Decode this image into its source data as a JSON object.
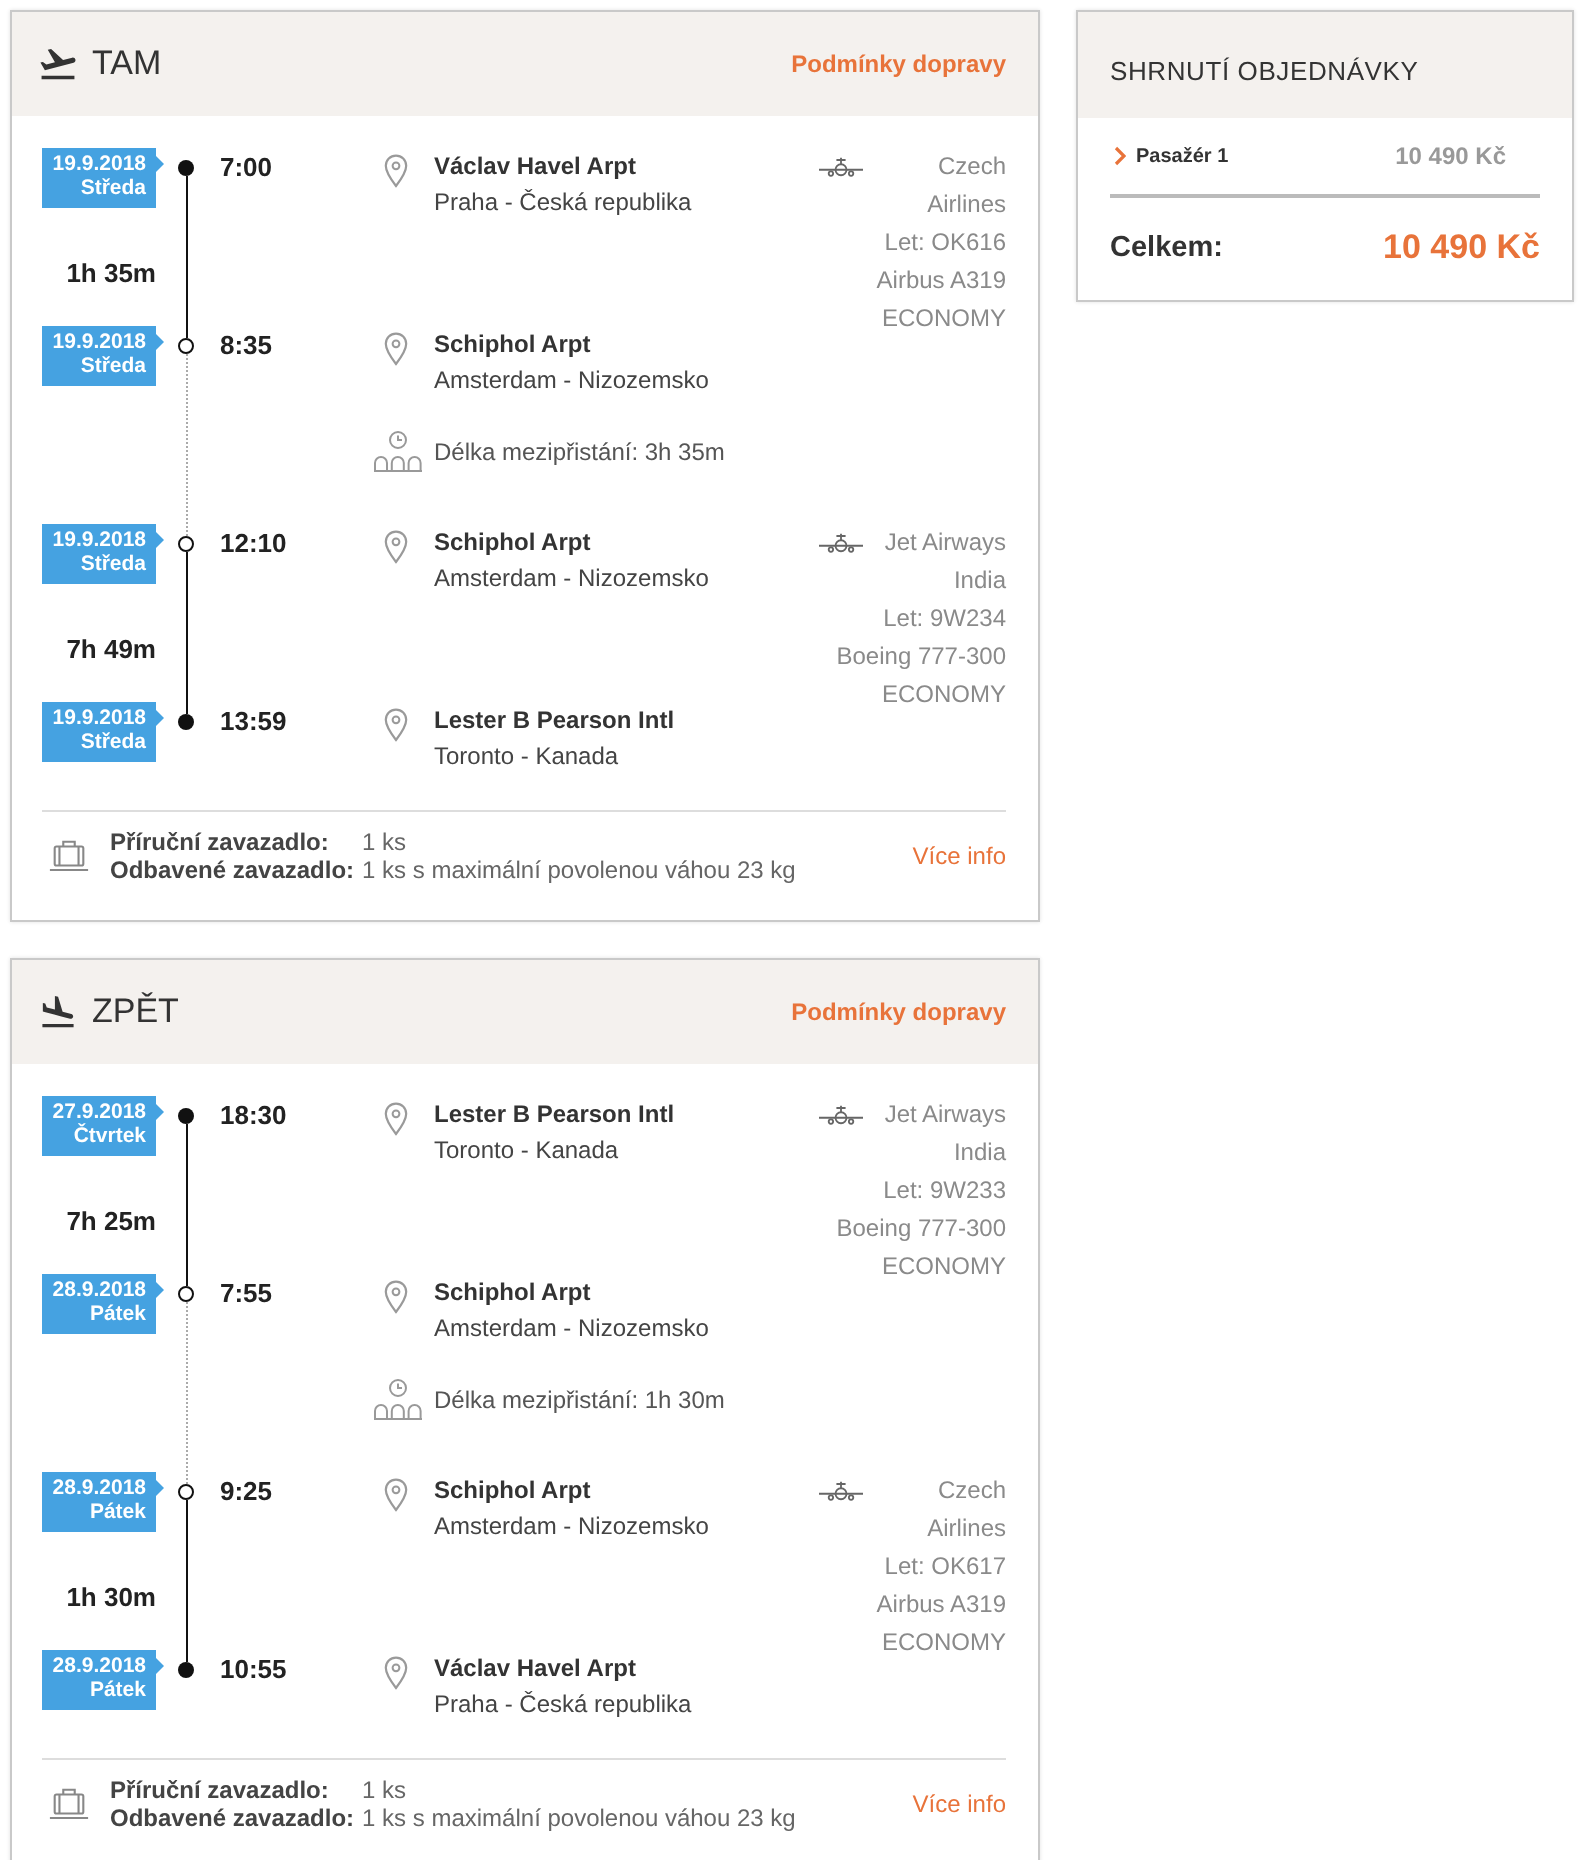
{
  "legs": [
    {
      "kind": "outbound",
      "title": "TAM",
      "conditions_link": "Podmínky dopravy",
      "segments": [
        {
          "kind": "flight",
          "departure": {
            "date": "19.9.2018",
            "weekday": "Středa",
            "time": "7:00",
            "airport": "Václav Havel Arpt",
            "city": "Praha - Česká republika",
            "endpoint": true
          },
          "duration": "1h 35m",
          "arrival": {
            "date": "19.9.2018",
            "weekday": "Středa",
            "time": "8:35",
            "airport": "Schiphol Arpt",
            "city": "Amsterdam - Nizozemsko",
            "endpoint": false
          },
          "airline": "Czech Airlines",
          "flight_number": "Let: OK616",
          "aircraft": "Airbus A319",
          "cabin_class": "ECONOMY"
        },
        {
          "kind": "layover",
          "text": "Délka mezipřistání: 3h 35m"
        },
        {
          "kind": "flight",
          "departure": {
            "date": "19.9.2018",
            "weekday": "Středa",
            "time": "12:10",
            "airport": "Schiphol Arpt",
            "city": "Amsterdam - Nizozemsko",
            "endpoint": false
          },
          "duration": "7h 49m",
          "arrival": {
            "date": "19.9.2018",
            "weekday": "Středa",
            "time": "13:59",
            "airport": "Lester B Pearson Intl",
            "city": "Toronto - Kanada",
            "endpoint": true
          },
          "airline": "Jet Airways India",
          "flight_number": "Let: 9W234",
          "aircraft": "Boeing 777-300",
          "cabin_class": "ECONOMY"
        }
      ],
      "baggage": {
        "rows": [
          {
            "label": "Příruční zavazadlo:",
            "value": "1 ks"
          },
          {
            "label": "Odbavené zavazadlo:",
            "value": "1 ks s maximální povolenou váhou 23 kg"
          }
        ],
        "link": "Více info"
      }
    },
    {
      "kind": "inbound",
      "title": "ZPĚT",
      "conditions_link": "Podmínky dopravy",
      "segments": [
        {
          "kind": "flight",
          "departure": {
            "date": "27.9.2018",
            "weekday": "Čtvrtek",
            "time": "18:30",
            "airport": "Lester B Pearson Intl",
            "city": "Toronto - Kanada",
            "endpoint": true
          },
          "duration": "7h 25m",
          "arrival": {
            "date": "28.9.2018",
            "weekday": "Pátek",
            "time": "7:55",
            "airport": "Schiphol Arpt",
            "city": "Amsterdam - Nizozemsko",
            "endpoint": false
          },
          "airline": "Jet Airways India",
          "flight_number": "Let: 9W233",
          "aircraft": "Boeing 777-300",
          "cabin_class": "ECONOMY"
        },
        {
          "kind": "layover",
          "text": "Délka mezipřistání: 1h 30m"
        },
        {
          "kind": "flight",
          "departure": {
            "date": "28.9.2018",
            "weekday": "Pátek",
            "time": "9:25",
            "airport": "Schiphol Arpt",
            "city": "Amsterdam - Nizozemsko",
            "endpoint": false
          },
          "duration": "1h 30m",
          "arrival": {
            "date": "28.9.2018",
            "weekday": "Pátek",
            "time": "10:55",
            "airport": "Václav Havel Arpt",
            "city": "Praha - Česká republika",
            "endpoint": true
          },
          "airline": "Czech Airlines",
          "flight_number": "Let: OK617",
          "aircraft": "Airbus A319",
          "cabin_class": "ECONOMY"
        }
      ],
      "baggage": {
        "rows": [
          {
            "label": "Příruční zavazadlo:",
            "value": "1 ks"
          },
          {
            "label": "Odbavené zavazadlo:",
            "value": "1 ks s maximální povolenou váhou 23 kg"
          }
        ],
        "link": "Více info"
      }
    }
  ],
  "summary": {
    "title": "SHRNUTÍ OBJEDNÁVKY",
    "items": [
      {
        "label": "Pasažér 1",
        "price": "10 490 Kč",
        "expanded": false
      }
    ],
    "total_label": "Celkem:",
    "total": "10 490 Kč"
  }
}
